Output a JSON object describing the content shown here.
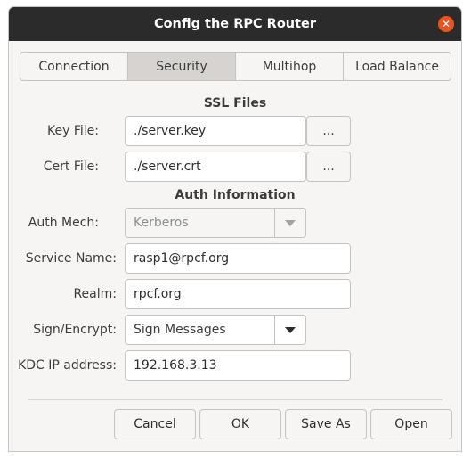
{
  "window": {
    "title": "Config the RPC Router",
    "close_icon": "close-icon"
  },
  "tabs": [
    {
      "label": "Connection",
      "active": false
    },
    {
      "label": "Security",
      "active": true
    },
    {
      "label": "Multihop",
      "active": false
    },
    {
      "label": "Load Balance",
      "active": false
    }
  ],
  "ssl": {
    "section_title": "SSL Files",
    "key_file_label": "Key File:",
    "key_file_value": "./server.key",
    "cert_file_label": "Cert File:",
    "cert_file_value": "./server.crt",
    "browse_label": "..."
  },
  "auth": {
    "section_title": "Auth Information",
    "auth_mech_label": "Auth Mech:",
    "auth_mech_value": "Kerberos",
    "service_name_label": "Service Name:",
    "service_name_value": "rasp1@rpcf.org",
    "realm_label": "Realm:",
    "realm_value": "rpcf.org",
    "sign_encrypt_label": "Sign/Encrypt:",
    "sign_encrypt_value": "Sign Messages",
    "kdc_ip_label": "KDC IP address:",
    "kdc_ip_value": "192.168.3.13"
  },
  "buttons": {
    "cancel": "Cancel",
    "ok": "OK",
    "save_as": "Save As",
    "open": "Open"
  },
  "colors": {
    "titlebar": "#2b2b2b",
    "close": "#e95420",
    "background": "#f6f5f4",
    "active_tab": "#d6d3d0"
  }
}
